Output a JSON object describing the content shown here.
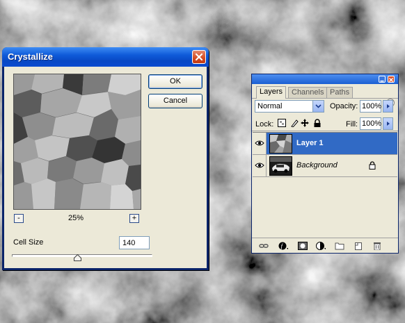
{
  "crystallize_dialog": {
    "title": "Crystallize",
    "ok_label": "OK",
    "cancel_label": "Cancel",
    "zoom_out_label": "-",
    "zoom_in_label": "+",
    "zoom_level": "25%",
    "cell_size_label": "Cell Size",
    "cell_size_value": "140",
    "cell_size_slider_fraction": 0.47
  },
  "layers_palette": {
    "tabs": [
      {
        "label": "Layers",
        "active": true
      },
      {
        "label": "Channels",
        "active": false
      },
      {
        "label": "Paths",
        "active": false
      }
    ],
    "blend_mode": "Normal",
    "opacity_label": "Opacity:",
    "opacity_value": "100%",
    "lock_label": "Lock:",
    "fill_label": "Fill:",
    "fill_value": "100%",
    "layers": [
      {
        "name": "Layer 1",
        "selected": true,
        "visible": true,
        "locked": false
      },
      {
        "name": "Background",
        "selected": false,
        "visible": true,
        "locked": true
      }
    ],
    "icons": {
      "lock_icons": [
        "lock-transparent-pixels-icon",
        "lock-image-pixels-icon",
        "lock-position-icon",
        "lock-all-icon"
      ],
      "footer_icons": [
        "link-layers-icon",
        "layer-style-icon",
        "layer-mask-icon",
        "adjustment-layer-icon",
        "new-group-icon",
        "new-layer-icon",
        "delete-layer-icon"
      ]
    }
  },
  "colors": {
    "selection_blue": "#316ac5",
    "titlebar_blue": "#0f5bd9",
    "dialog_face": "#ece9d8",
    "close_red": "#d44a20"
  }
}
